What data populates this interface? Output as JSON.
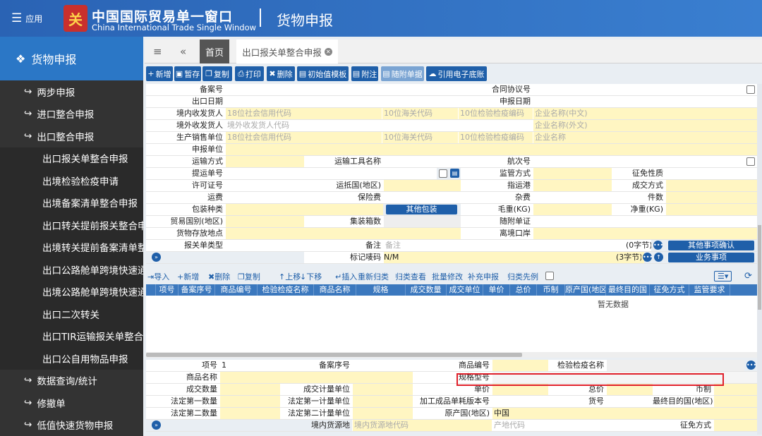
{
  "header": {
    "menu_label": "应用",
    "logo_glyph": "关",
    "title_cn": "中国国际贸易单一窗口",
    "title_en": "China International Trade Single Window",
    "section": "货物申报"
  },
  "sidebar": {
    "head": "货物申报",
    "items": [
      {
        "label": "两步申报",
        "icon": "↪",
        "level": "lv1"
      },
      {
        "label": "进口整合申报",
        "icon": "↪",
        "level": "lv1"
      },
      {
        "label": "出口整合申报",
        "icon": "↪",
        "level": "lv1"
      },
      {
        "label": "出口报关单整合申报",
        "icon": "",
        "level": "sub"
      },
      {
        "label": "出境检验检疫申请",
        "icon": "",
        "level": "sub"
      },
      {
        "label": "出境备案清单整合申报",
        "icon": "",
        "level": "sub"
      },
      {
        "label": "出口转关提前报关整合申报",
        "icon": "",
        "level": "sub"
      },
      {
        "label": "出境转关提前备案清单整合申报",
        "icon": "",
        "level": "sub"
      },
      {
        "label": "出口公路舱单跨境快速通关",
        "icon": "",
        "level": "sub"
      },
      {
        "label": "出境公路舱单跨境快速通关",
        "icon": "",
        "level": "sub"
      },
      {
        "label": "出口二次转关",
        "icon": "",
        "level": "sub"
      },
      {
        "label": "出口TIR运输报关单整合申报",
        "icon": "",
        "level": "sub"
      },
      {
        "label": "出口公自用物品申报",
        "icon": "",
        "level": "sub"
      },
      {
        "label": "数据查询/统计",
        "icon": "↪",
        "level": "lv1"
      },
      {
        "label": "修撤单",
        "icon": "↪",
        "level": "lv1"
      },
      {
        "label": "低值快速货物申报",
        "icon": "↪",
        "level": "lv1"
      }
    ]
  },
  "tabs": {
    "home": "首页",
    "active": "出口报关单整合申报"
  },
  "toolbar": [
    {
      "label": "新增",
      "icon": "+"
    },
    {
      "label": "暂存",
      "icon": "▣"
    },
    {
      "label": "复制",
      "icon": "❐"
    },
    {
      "label": "打印",
      "icon": "⎙"
    },
    {
      "label": "删除",
      "icon": "✖"
    },
    {
      "label": "初始值模板",
      "icon": "▤"
    },
    {
      "label": "附注",
      "icon": "▤"
    },
    {
      "label": "随附单据",
      "icon": "▤"
    },
    {
      "label": "引用电子底账",
      "icon": "☁"
    }
  ],
  "form": {
    "beian": "备案号",
    "hetong": "合同协议号",
    "chukou_date": "出口日期",
    "shenbao_date": "申报日期",
    "jingnei": "境内收发货人",
    "ph_xinyong": "18位社会信用代码",
    "ph_haiguan": "10位海关代码",
    "ph_jianyi": "10位检验检疫编码",
    "ph_name_cn": "企业名称(中文)",
    "jingwai": "境外收发货人",
    "ph_jingwai": "境外收发货人代码",
    "ph_name_en": "企业名称(外文)",
    "shengchan": "生产销售单位",
    "ph_name": "企业名称",
    "shenbao_danwei": "申报单位",
    "yunshu_fangshi": "运输方式",
    "yunshu_gongju": "运输工具名称",
    "hangci": "航次号",
    "tiyun": "提运单号",
    "jianguan": "监管方式",
    "zhengmian": "征免性质",
    "xuke": "许可证号",
    "yundi": "运抵国(地区)",
    "zhiyun": "指运港",
    "chengjiao": "成交方式",
    "yunfei": "运费",
    "baoxian": "保险费",
    "zafei": "杂费",
    "jianshu": "件数",
    "baozhuang": "包装种类",
    "other_pack": "其他包装",
    "maozhong": "毛重(KG)",
    "jingzhong": "净重(KG)",
    "maoyi": "贸易国别(地区)",
    "jizhuangxiang": "集装箱数",
    "suifu": "随附单证",
    "cunfang": "货物存放地点",
    "likou": "离境口岸",
    "baoguan_type": "报关单类型",
    "beizhu": "备注",
    "ph_beizhu": "备注",
    "bytes0": "(0字节)",
    "other_confirm": "其他事项确认",
    "biaoji": "标记唛码",
    "biaoji_val": "N/M",
    "bytes3": "(3字节)",
    "yewu": "业务事项"
  },
  "grid_toolbar": [
    {
      "label": "导入",
      "icon": "⇥"
    },
    {
      "label": "新增",
      "icon": "+"
    },
    {
      "label": "删除",
      "icon": "✖"
    },
    {
      "label": "复制",
      "icon": "❐"
    },
    {
      "label": "上移",
      "icon": "↑"
    },
    {
      "label": "下移",
      "icon": "↓"
    },
    {
      "label": "插入",
      "icon": "↵"
    },
    {
      "label": "重新归类",
      "icon": ""
    },
    {
      "label": "归类查看",
      "icon": ""
    },
    {
      "label": "批量修改",
      "icon": ""
    },
    {
      "label": "补充申报",
      "icon": ""
    },
    {
      "label": "归类先例",
      "icon": ""
    }
  ],
  "grid_columns": [
    "项号",
    "备案序号",
    "商品编号",
    "检验检疫名称",
    "商品名称",
    "规格",
    "成交数量",
    "成交单位",
    "单价",
    "总价",
    "币制",
    "原产国(地区)",
    "最终目的国",
    "征免方式",
    "监管要求"
  ],
  "grid_empty": "暂无数据",
  "detail": {
    "xianghao": "项号",
    "xianghao_val": "1",
    "beian_xuhao": "备案序号",
    "shangpin_bianhao": "商品编号",
    "jianyi_name": "检验检疫名称",
    "shangpin_name": "商品名称",
    "guige": "规格型号",
    "chengjiao_shuliang": "成交数量",
    "chengjiao_jiliang": "成交计量单位",
    "danjia": "单价",
    "zongjia": "总价",
    "bizhi": "币制",
    "fading1": "法定第一数量",
    "fading1_unit": "法定第一计量单位",
    "jiagong": "加工成品单耗版本号",
    "huohao": "货号",
    "zuizhong": "最终目的国(地区)",
    "fading2": "法定第二数量",
    "fading2_unit": "法定第二计量单位",
    "yuanchan": "原产国(地区)",
    "yuanchan_val": "中国",
    "jingnei_huoyuan": "境内货源地",
    "ph_huoyuan": "境内货源地代码",
    "ph_chandi": "产地代码",
    "zhengmian_fs": "征免方式"
  }
}
